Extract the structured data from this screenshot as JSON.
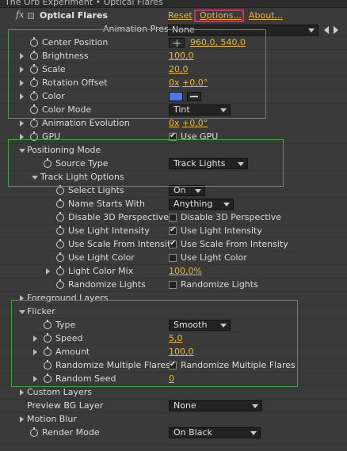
{
  "title_bar": "The Orb Experiment • Optical Flares",
  "effect": {
    "fx_label": "fx",
    "name": "Optical Flares",
    "reset_label": "Reset",
    "options_label": "Options...",
    "about_label": "About..."
  },
  "presets": {
    "label": "Animation Presets:",
    "value": "None"
  },
  "props": {
    "center_position": {
      "label": "Center Position",
      "value": "960,0, 540,0"
    },
    "brightness": {
      "label": "Brightness",
      "value": "100,0"
    },
    "scale": {
      "label": "Scale",
      "value": "20,0"
    },
    "rotation_offset": {
      "label": "Rotation Offset",
      "value_turns": "0x",
      "value_deg": "+0,0°"
    },
    "color": {
      "label": "Color",
      "swatch_color": "#4a78e8"
    },
    "color_mode": {
      "label": "Color Mode",
      "value": "Tint"
    },
    "animation_evolution": {
      "label": "Animation Evolution",
      "value_turns": "0x",
      "value_deg": "+0,0°"
    },
    "gpu": {
      "label": "GPU",
      "checkbox_label": "Use GPU",
      "checked": true
    },
    "positioning_mode": {
      "label": "Positioning Mode"
    },
    "source_type": {
      "label": "Source Type",
      "value": "Track Lights"
    },
    "track_light_options": {
      "label": "Track Light Options"
    },
    "select_lights": {
      "label": "Select Lights",
      "value": "On"
    },
    "name_starts_with": {
      "label": "Name Starts With",
      "value": "Anything"
    },
    "disable_3d_perspective": {
      "label": "Disable 3D Perspective",
      "checkbox_label": "Disable 3D Perspective",
      "checked": false
    },
    "use_light_intensity": {
      "label": "Use Light Intensity",
      "checkbox_label": "Use Light Intensity",
      "checked": true
    },
    "use_scale_from_intensity": {
      "label": "Use Scale From Intensit",
      "checkbox_label": "Use Scale From Intensity",
      "checked": true
    },
    "use_light_color": {
      "label": "Use Light Color",
      "checkbox_label": "Use Light Color",
      "checked": false
    },
    "light_color_mix": {
      "label": "Light Color Mix",
      "value": "100,0%"
    },
    "randomize_lights": {
      "label": "Randomize Lights",
      "checkbox_label": "Randomize Lights",
      "checked": false
    },
    "foreground_layers": {
      "label": "Foreground Layers"
    },
    "flicker": {
      "label": "Flicker"
    },
    "type": {
      "label": "Type",
      "value": "Smooth"
    },
    "speed": {
      "label": "Speed",
      "value": "5,0"
    },
    "amount": {
      "label": "Amount",
      "value": "100,0"
    },
    "randomize_multiple_flares": {
      "label": "Randomize Multiple Flares",
      "checkbox_label": "Randomize Multiple Flares",
      "checked": true
    },
    "random_seed": {
      "label": "Random Seed",
      "value": "0"
    },
    "custom_layers": {
      "label": "Custom Layers"
    },
    "preview_bg_layer": {
      "label": "Preview BG Layer",
      "value": "None"
    },
    "motion_blur": {
      "label": "Motion Blur"
    },
    "render_mode": {
      "label": "Render Mode",
      "value": "On Black"
    }
  },
  "colors": {
    "accent_link": "#e8b838",
    "highlight_box": "#3ea83e",
    "options_highlight": "#d03060"
  }
}
